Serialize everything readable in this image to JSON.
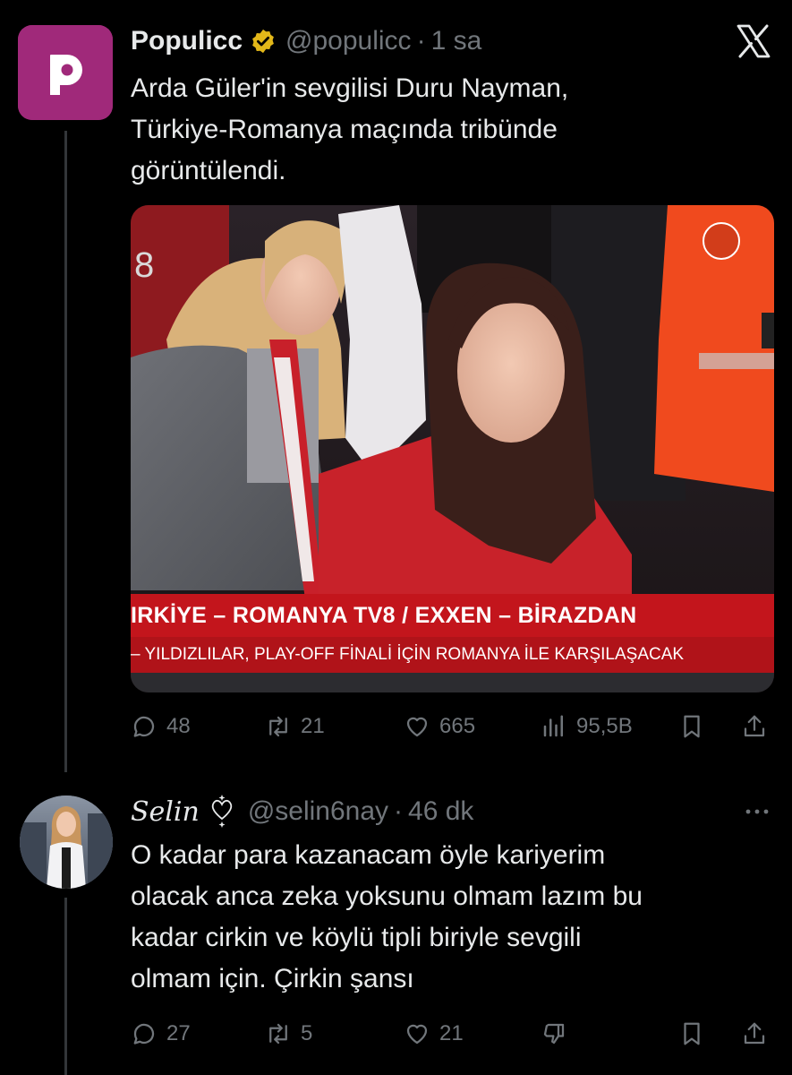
{
  "tweet1": {
    "author_name": "Populicc",
    "handle": "@populicc",
    "separator": "·",
    "time": "1 sa",
    "text_lines": [
      "Arda Güler'in sevgilisi Duru Nayman,",
      "Türkiye-Romanya maçında tribünde",
      "görüntülendi."
    ],
    "media": {
      "ticker_line1": "IRKİYE – ROMANYA     TV8 / EXXEN – BİRAZDAN",
      "ticker_line2": "– YILDIZLILAR, PLAY-OFF FİNALİ İÇİN ROMANYA İLE KARŞILAŞACAK"
    },
    "actions": {
      "replies": "48",
      "retweets": "21",
      "likes": "665",
      "views": "95,5B"
    }
  },
  "tweet2": {
    "author_name": "Selin",
    "handle": "@selin6nay",
    "separator": "·",
    "time": "46 dk",
    "text_lines": [
      "O kadar para kazanacam öyle kariyerim",
      "olacak anca zeka yoksunu olmam lazım bu",
      "kadar cirkin ve  köylü tipli biriyle sevgili",
      "olmam için. Çirkin şansı"
    ],
    "actions": {
      "replies": "27",
      "retweets": "5",
      "likes": "21"
    }
  },
  "colors": {
    "background": "#000000",
    "text_primary": "#e7e9ea",
    "text_secondary": "#71767b",
    "verified_gold": "#e2b719",
    "populicc_brand": "#a0297a",
    "ticker_red": "#c3151c"
  },
  "icons": [
    "populicc-logo-icon",
    "verified-badge-icon",
    "x-logo-icon",
    "reply-icon",
    "retweet-icon",
    "like-icon",
    "views-icon",
    "bookmark-icon",
    "share-icon",
    "more-icon",
    "dislike-icon",
    "heart-decoration-icon"
  ]
}
